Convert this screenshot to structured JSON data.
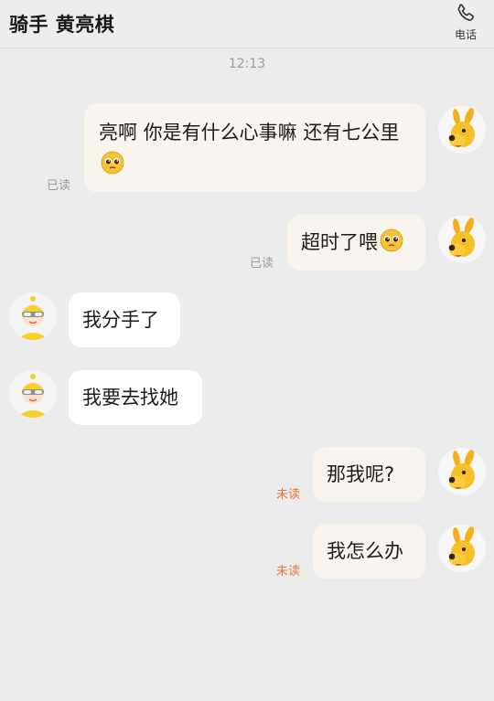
{
  "header": {
    "title": "骑手 黄亮棋",
    "call_label": "电话"
  },
  "chat": {
    "time": "12:13",
    "messages": [
      {
        "text": "亮啊 你是有什么心事嘛 还有七公里",
        "status": "已读"
      },
      {
        "text": "超时了喂",
        "status": "已读"
      },
      {
        "text": "我分手了"
      },
      {
        "text": "我要去找她"
      },
      {
        "text": "那我呢?",
        "status": "未读"
      },
      {
        "text": "我怎么办",
        "status": "未读"
      }
    ]
  },
  "icons": {
    "phone": "phone-icon",
    "emoji": "pleading-face-emoji",
    "user_avatar": "dog-avatar",
    "rider_avatar": "rider-avatar"
  },
  "colors": {
    "unread": "#e8743b",
    "outgoing_bubble": "#f9f5ec"
  }
}
